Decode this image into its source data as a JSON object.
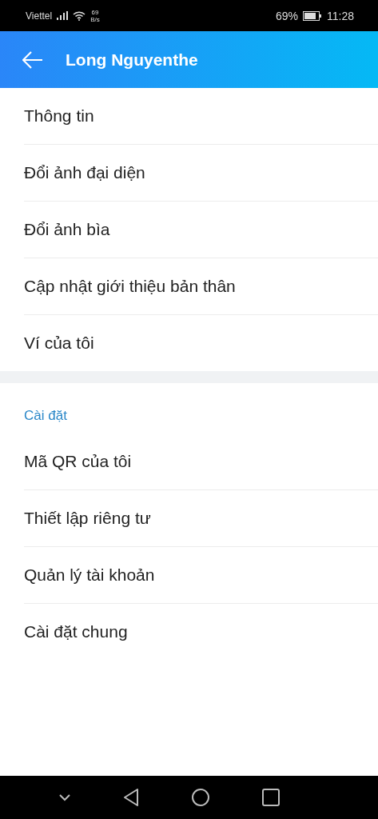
{
  "status_bar": {
    "carrier": "Viettel",
    "speed_value": "69",
    "speed_unit": "B/s",
    "battery": "69%",
    "time": "11:28"
  },
  "header": {
    "title": "Long Nguyenthe"
  },
  "groups": [
    {
      "items": [
        "Thông tin",
        "Đổi ảnh đại diện",
        "Đổi ảnh bìa",
        "Cập nhật giới thiệu bản thân",
        "Ví của tôi"
      ]
    },
    {
      "title": "Cài đặt",
      "items": [
        "Mã QR của tôi",
        "Thiết lập riêng tư",
        "Quản lý tài khoản",
        "Cài đặt chung"
      ]
    }
  ]
}
